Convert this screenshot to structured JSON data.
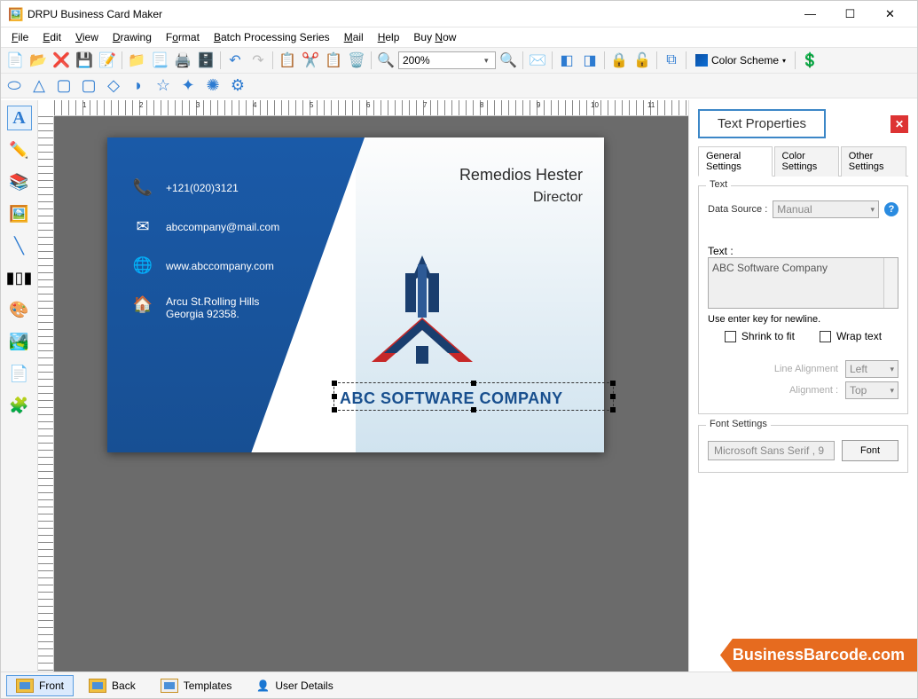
{
  "app_title": "DRPU Business Card Maker",
  "menu": [
    "File",
    "Edit",
    "View",
    "Drawing",
    "Format",
    "Batch Processing Series",
    "Mail",
    "Help",
    "Buy Now"
  ],
  "zoom": "200%",
  "color_scheme_label": "Color Scheme",
  "ruler_marks": [
    "1",
    "2",
    "3",
    "4",
    "5",
    "6",
    "7",
    "8",
    "9",
    "10",
    "11"
  ],
  "card": {
    "phone": "+121(020)3121",
    "email": "abccompany@mail.com",
    "website": "www.abccompany.com",
    "address1": "Arcu St.Rolling Hills",
    "address2": "Georgia 92358.",
    "name": "Remedios Hester",
    "role": "Director",
    "company": "ABC SOFTWARE COMPANY"
  },
  "panel": {
    "title": "Text Properties",
    "tabs": [
      "General Settings",
      "Color Settings",
      "Other Settings"
    ],
    "group_text": "Text",
    "data_source_label": "Data Source :",
    "data_source_value": "Manual",
    "text_label": "Text :",
    "text_value": "ABC Software Company",
    "hint": "Use enter key for newline.",
    "shrink": "Shrink to fit",
    "wrap": "Wrap text",
    "line_alignment_label": "Line Alignment",
    "line_alignment_value": "Left",
    "alignment_label": "Alignment :",
    "alignment_value": "Top",
    "font_group": "Font Settings",
    "font_display": "Microsoft Sans Serif , 9",
    "font_btn": "Font"
  },
  "bottom": [
    "Front",
    "Back",
    "Templates",
    "User Details"
  ],
  "watermark": "BusinessBarcode.com"
}
